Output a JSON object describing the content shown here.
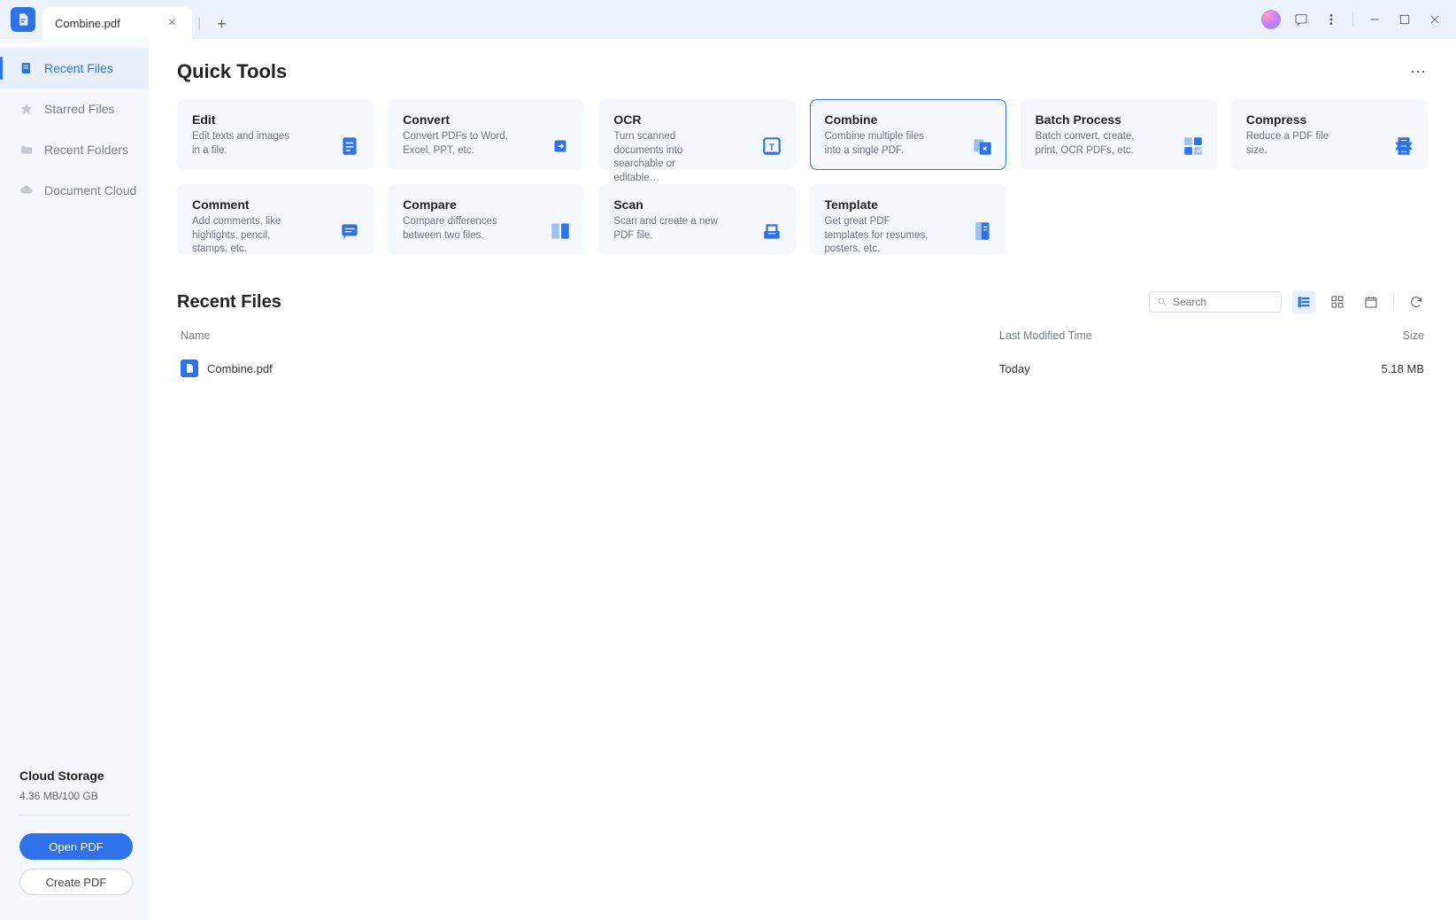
{
  "titlebar": {
    "tab_name": "Combine.pdf"
  },
  "sidebar": {
    "items": [
      {
        "label": "Recent Files",
        "active": true
      },
      {
        "label": "Starred Files"
      },
      {
        "label": "Recent Folders"
      },
      {
        "label": "Document Cloud"
      }
    ],
    "cloud_title": "Cloud Storage",
    "cloud_usage": "4.36 MB/100 GB",
    "open_btn": "Open PDF",
    "create_btn": "Create PDF"
  },
  "quick_tools": {
    "title": "Quick Tools",
    "tools": [
      {
        "title": "Edit",
        "desc": "Edit texts and images in a file."
      },
      {
        "title": "Convert",
        "desc": "Convert PDFs to Word, Excel, PPT, etc."
      },
      {
        "title": "OCR",
        "desc": "Turn scanned documents into searchable or editable…"
      },
      {
        "title": "Combine",
        "desc": "Combine multiple files into a single PDF.",
        "selected": true
      },
      {
        "title": "Batch Process",
        "desc": "Batch convert, create, print, OCR PDFs, etc."
      },
      {
        "title": "Compress",
        "desc": "Reduce a PDF file size."
      },
      {
        "title": "Comment",
        "desc": "Add comments, like highlights, pencil, stamps, etc."
      },
      {
        "title": "Compare",
        "desc": "Compare differences between two files."
      },
      {
        "title": "Scan",
        "desc": "Scan and create a new PDF file."
      },
      {
        "title": "Template",
        "desc": "Get great PDF templates for resumes, posters, etc."
      }
    ]
  },
  "recent": {
    "title": "Recent Files",
    "search_placeholder": "Search",
    "columns": {
      "name": "Name",
      "time": "Last Modified Time",
      "size": "Size"
    },
    "rows": [
      {
        "name": "Combine.pdf",
        "time": "Today",
        "size": "5.18 MB"
      }
    ]
  }
}
